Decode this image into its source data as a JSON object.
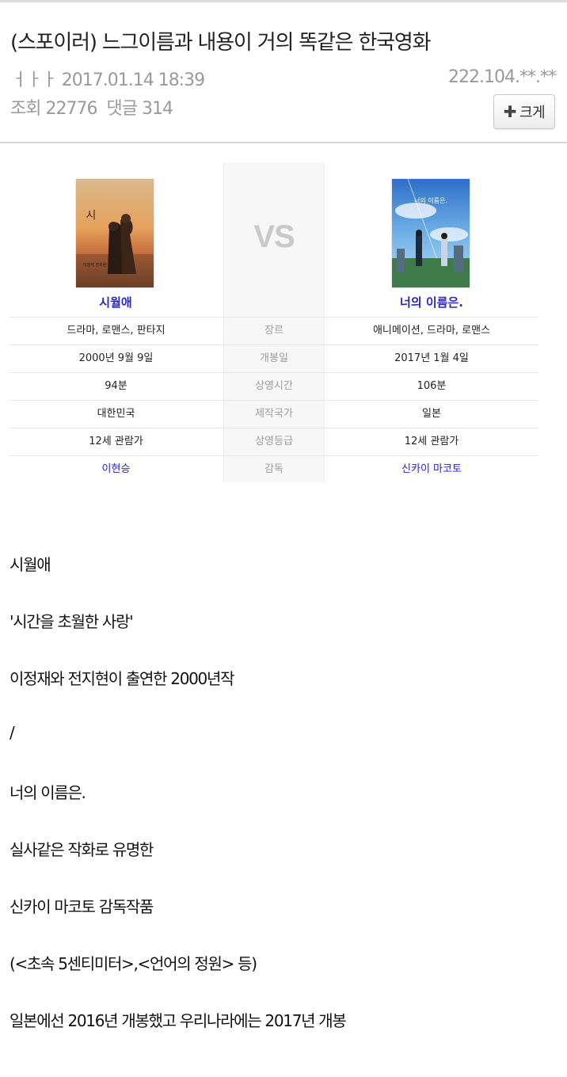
{
  "post": {
    "title": "(스포이러) 느그이름과 내용이 거의 똑같은 한국영화",
    "author": "ㅓㅏㅏ",
    "datetime": "2017.01.14 18:39",
    "ip": "222.104.**.**",
    "views_label": "조회",
    "views": "22776",
    "comments_label": "댓글",
    "comments": "314",
    "size_button": "크게"
  },
  "compare": {
    "vs_label": "VS",
    "left_title": "시월애",
    "right_title": "너의 이름은.",
    "left_poster_text": "시월애",
    "right_poster_text": "너의 이름은.",
    "rows": [
      {
        "label": "장르",
        "left": "드라마, 로맨스, 판타지",
        "right": "애니메이션, 드라마, 로맨스"
      },
      {
        "label": "개봉일",
        "left": "2000년 9월 9일",
        "right": "2017년 1월 4일"
      },
      {
        "label": "상영시간",
        "left": "94분",
        "right": "106분"
      },
      {
        "label": "제작국가",
        "left": "대한민국",
        "right": "일본"
      },
      {
        "label": "상영등급",
        "left": "12세 관람가",
        "right": "12세 관람가"
      },
      {
        "label": "감독",
        "left": "이현승",
        "right": "신카이 마코토"
      }
    ]
  },
  "body": [
    "시월애",
    "'시간을 초월한 사랑'",
    "이정재와 전지현이 출연한 2000년작",
    "/",
    "너의 이름은.",
    "실사같은 작화로 유명한",
    "신카이 마코토 감독작품",
    "(<초속 5센티미터>,<언어의 정원> 등)",
    "일본에선 2016년 개봉했고 우리나라에는 2017년 개봉"
  ],
  "colors": {
    "link": "#2a25c4",
    "meta": "#9a9a9a",
    "vs": "#c9c9c9"
  }
}
